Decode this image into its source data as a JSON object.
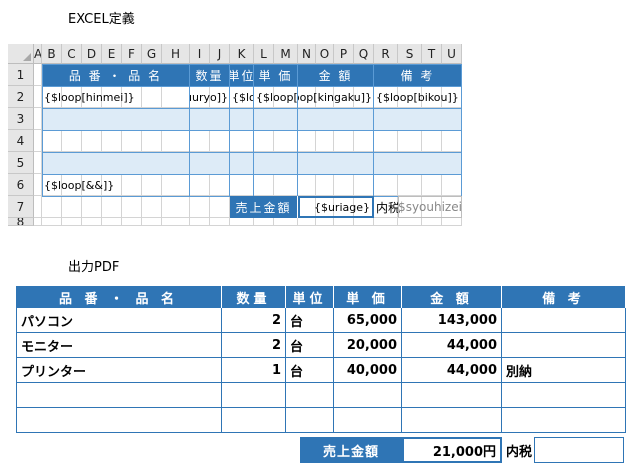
{
  "excel_title": "EXCEL定義",
  "pdf_title": "出力PDF",
  "sheet": {
    "columns": [
      "A",
      "B",
      "C",
      "D",
      "E",
      "F",
      "G",
      "H",
      "I",
      "J",
      "K",
      "L",
      "M",
      "N",
      "O",
      "P",
      "Q",
      "R",
      "S",
      "T",
      "U"
    ],
    "rows": [
      "1",
      "2",
      "3",
      "4",
      "5",
      "6",
      "7",
      "8"
    ],
    "headers": [
      "品 番 ・ 品  名",
      "数量",
      "単位",
      "単 価",
      "金 額",
      "備 考"
    ],
    "row2": [
      "{$loop[hinmei]}",
      "{$loop[suuryo]}",
      "{$loop[ta",
      "{$loop[tanka]}",
      "{$loop[kingaku]}",
      "{$loop[bikou]}"
    ],
    "row6": "{$loop[&&]}",
    "total_label": "売上金額",
    "total_value": "{$uriage}",
    "tax_label": "内税",
    "tax_value": "{$syouhizei}"
  },
  "pdf": {
    "headers": [
      "品 番 ・ 品  名",
      "数量",
      "単位",
      "単 価",
      "金 額",
      "備 考"
    ],
    "rows": [
      [
        "パソコン",
        "2",
        "台",
        "65,000",
        "143,000",
        ""
      ],
      [
        "モニター",
        "2",
        "台",
        "20,000",
        "44,000",
        ""
      ],
      [
        "プリンター",
        "1",
        "台",
        "40,000",
        "44,000",
        "別納"
      ],
      [
        "",
        "",
        "",
        "",
        "",
        ""
      ],
      [
        "",
        "",
        "",
        "",
        "",
        ""
      ]
    ],
    "total_label": "売上金額",
    "total_value": "21,000円",
    "tax_label": "内税",
    "tax_value": ""
  },
  "colors": {
    "header_blue": "#2f75b5",
    "band_blue": "#ddebf7",
    "border_blue": "#5b9bd5"
  }
}
